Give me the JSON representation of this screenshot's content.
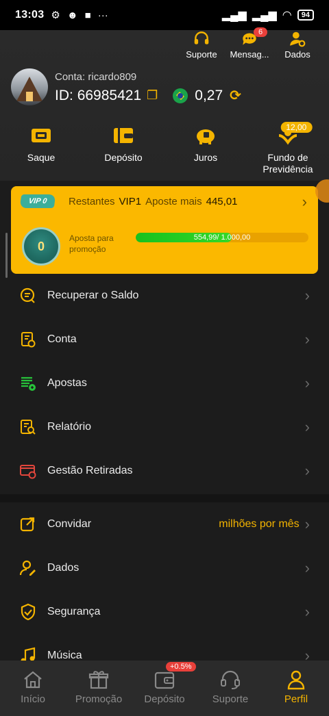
{
  "status_bar": {
    "time": "13:03",
    "battery": "94"
  },
  "top_actions": [
    {
      "label": "Suporte",
      "icon": "headset-icon"
    },
    {
      "label": "Mensag...",
      "icon": "chat-bubble-icon",
      "badge": "6"
    },
    {
      "label": "Dados",
      "icon": "user-gear-icon"
    }
  ],
  "profile": {
    "conta_label": "Conta:",
    "username": "ricardo809",
    "id_label": "ID:",
    "id_value": "66985421",
    "balance": "0,27"
  },
  "shortcuts": [
    {
      "label": "Saque",
      "icon": "ticket-icon"
    },
    {
      "label": "Depósito",
      "icon": "wallet-icon"
    },
    {
      "label": "Juros",
      "icon": "piggy-bank-icon"
    },
    {
      "label": "Fundo de Previdência",
      "icon": "hands-coin-icon",
      "badge": "12,00"
    }
  ],
  "vip": {
    "badge": "VIP 0",
    "restantes": "Restantes",
    "level": "VIP1",
    "aposte_mais": "Aposte mais",
    "amount": "445,01",
    "medal": "0",
    "aposta_label": "Aposta para promoção",
    "progress_text": "554,99/ 1.000,00",
    "progress_fraction": 0.555
  },
  "menu_group1": [
    {
      "label": "Recuperar o Saldo",
      "icon": "recover-balance-icon"
    },
    {
      "label": "Conta",
      "icon": "account-doc-icon"
    },
    {
      "label": "Apostas",
      "icon": "bets-list-icon"
    },
    {
      "label": "Relatório",
      "icon": "report-search-icon"
    },
    {
      "label": "Gestão Retiradas",
      "icon": "withdraw-card-icon"
    }
  ],
  "menu_group2": [
    {
      "label": "Convidar",
      "icon": "share-icon",
      "hint": "milhões por mês"
    },
    {
      "label": "Dados",
      "icon": "user-edit-icon"
    },
    {
      "label": "Segurança",
      "icon": "shield-check-icon"
    },
    {
      "label": "Música",
      "icon": "music-note-icon"
    }
  ],
  "bottom_nav": [
    {
      "label": "Início",
      "icon": "home-icon"
    },
    {
      "label": "Promoção",
      "icon": "gift-icon"
    },
    {
      "label": "Depósito",
      "icon": "wallet-icon",
      "badge": "+0.5%"
    },
    {
      "label": "Suporte",
      "icon": "headset-icon"
    },
    {
      "label": "Perfil",
      "icon": "person-icon",
      "active": true
    }
  ],
  "colors": {
    "accent": "#f4b400",
    "background": "#1c1c1c",
    "vip_card": "#fbb800",
    "progress": "#22c922"
  }
}
